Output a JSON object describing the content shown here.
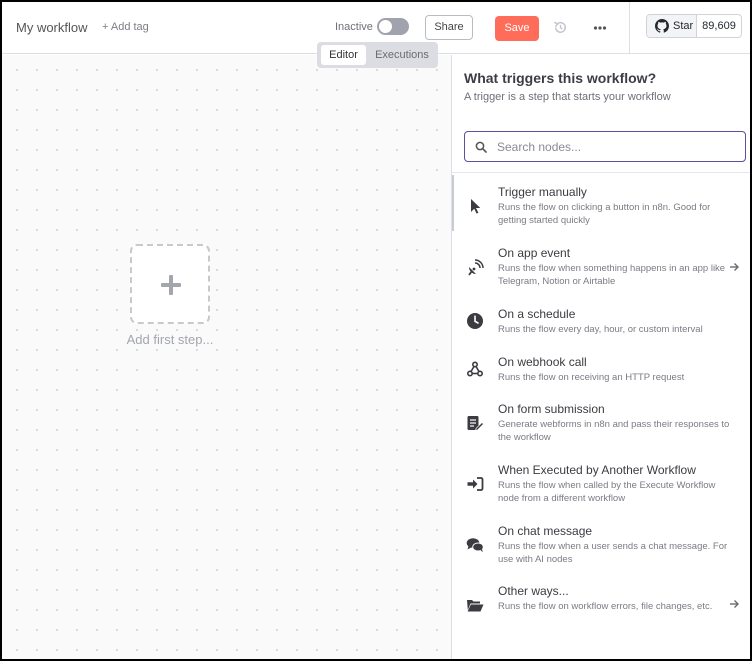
{
  "header": {
    "workflow_name": "My workflow",
    "add_tag": "+ Add tag",
    "status_label": "Inactive",
    "active": false,
    "share_label": "Share",
    "save_label": "Save",
    "undo_icon": "history-icon",
    "more_icon": "ellipsis-icon",
    "github": {
      "star_label": "Star",
      "star_count": "89,609",
      "icon": "github-icon"
    },
    "accent_color": "#ff6d5a"
  },
  "tabs": {
    "editor": "Editor",
    "executions": "Executions",
    "active": "Editor"
  },
  "canvas": {
    "add_first_step": "Add first step..."
  },
  "panel": {
    "title": "What triggers this workflow?",
    "subtitle": "A trigger is a step that starts your workflow",
    "search_placeholder": "Search nodes...",
    "items": [
      {
        "title": "Trigger manually",
        "desc": "Runs the flow on clicking a button in n8n. Good for getting started quickly",
        "icon": "cursor-icon",
        "arrow": false
      },
      {
        "title": "On app event",
        "desc": "Runs the flow when something happens in an app like Telegram, Notion or Airtable",
        "icon": "satellite-icon",
        "arrow": true
      },
      {
        "title": "On a schedule",
        "desc": "Runs the flow every day, hour, or custom interval",
        "icon": "clock-icon",
        "arrow": false
      },
      {
        "title": "On webhook call",
        "desc": "Runs the flow on receiving an HTTP request",
        "icon": "webhook-icon",
        "arrow": false
      },
      {
        "title": "On form submission",
        "desc": "Generate webforms in n8n and pass their responses to the workflow",
        "icon": "form-icon",
        "arrow": false
      },
      {
        "title": "When Executed by Another Workflow",
        "desc": "Runs the flow when called by the Execute Workflow node from a different workflow",
        "icon": "sign-in-icon",
        "arrow": false
      },
      {
        "title": "On chat message",
        "desc": "Runs the flow when a user sends a chat message. For use with AI nodes",
        "icon": "comments-icon",
        "arrow": false
      },
      {
        "title": "Other ways...",
        "desc": "Runs the flow on workflow errors, file changes, etc.",
        "icon": "folder-open-icon",
        "arrow": true
      }
    ]
  }
}
